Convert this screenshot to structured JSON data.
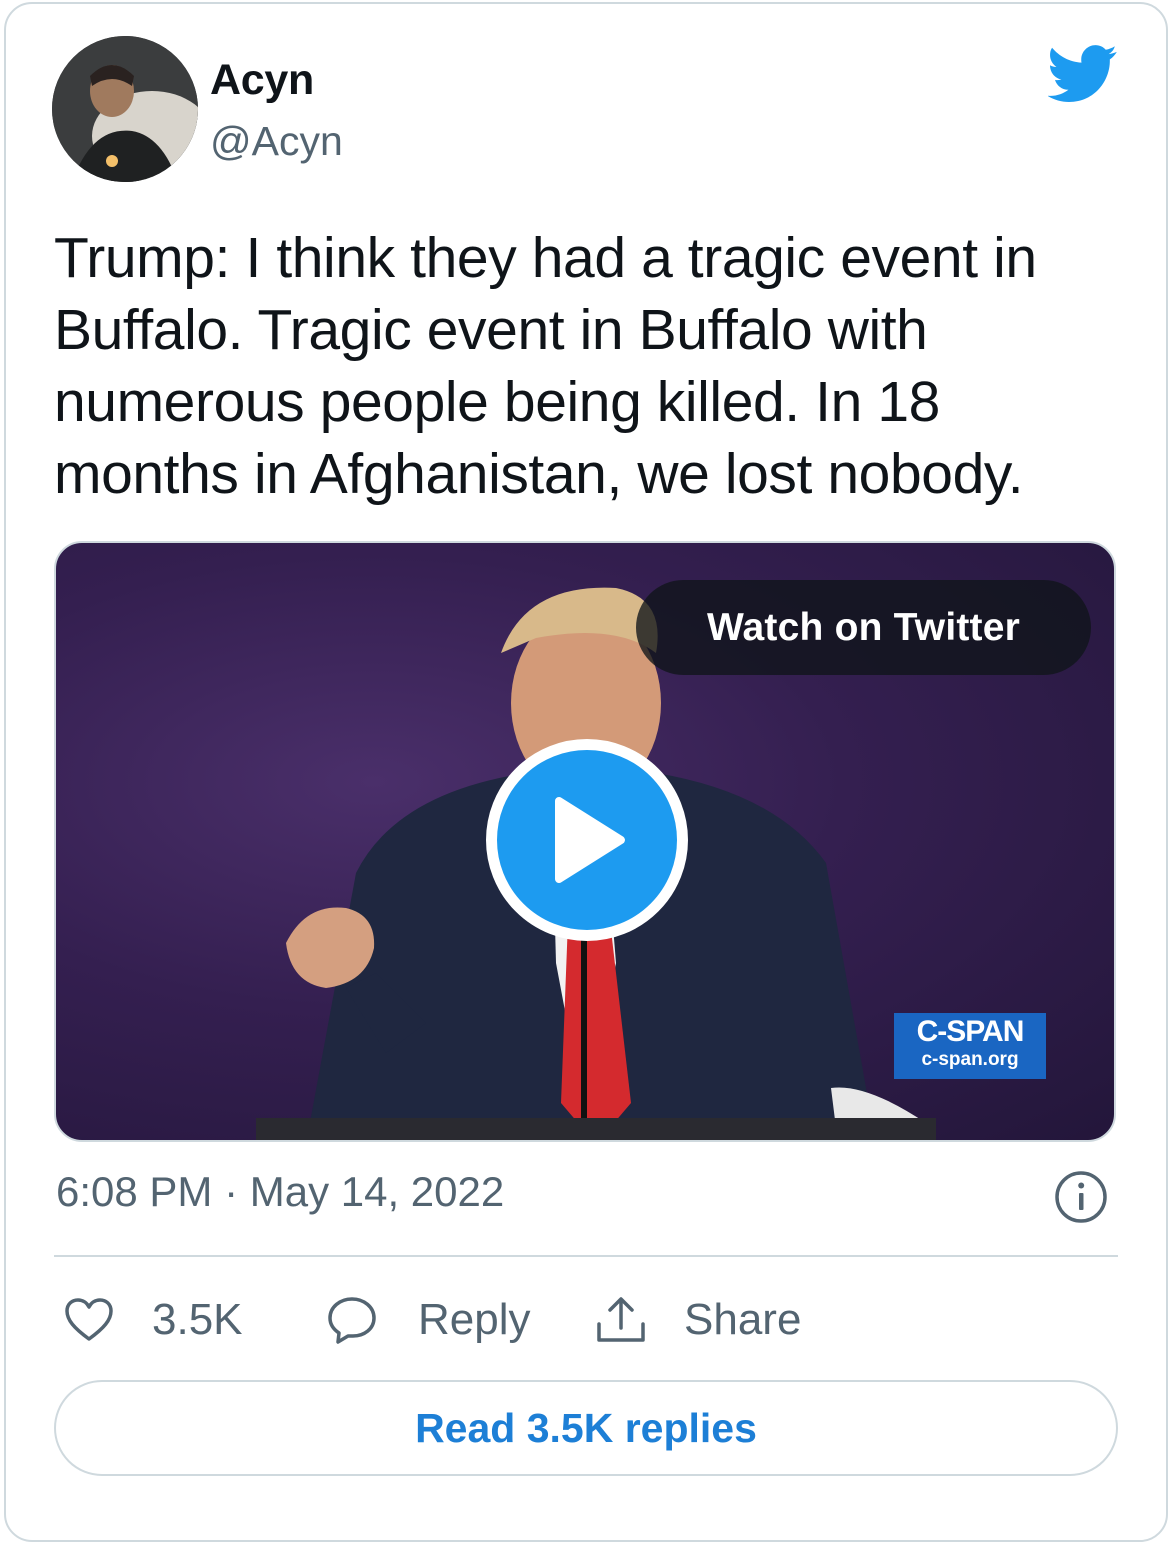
{
  "author": {
    "name": "Acyn",
    "handle": "@Acyn"
  },
  "tweet": {
    "text": "Trump: I think they had a tragic event in Buffalo. Tragic event in Buffalo with numerous people being killed. In 18 months in Afghanistan, we lost nobody."
  },
  "media": {
    "watch_label": "Watch on Twitter",
    "watermark_brand": "C-SPAN",
    "watermark_url": "c-span.org"
  },
  "timestamp": "6:08 PM · May 14, 2022",
  "actions": {
    "like_count": "3.5K",
    "reply_label": "Reply",
    "share_label": "Share"
  },
  "read_replies_label": "Read 3.5K replies",
  "icons": {
    "brand": "twitter-bird-icon",
    "play": "play-icon",
    "info": "info-icon",
    "like": "heart-icon",
    "reply": "speech-bubble-icon",
    "share": "share-upload-icon"
  },
  "colors": {
    "accent": "#1d9bf0",
    "link": "#1d7fd6",
    "muted_text": "#536471",
    "border": "#cfd9de",
    "text": "#0f1419"
  }
}
